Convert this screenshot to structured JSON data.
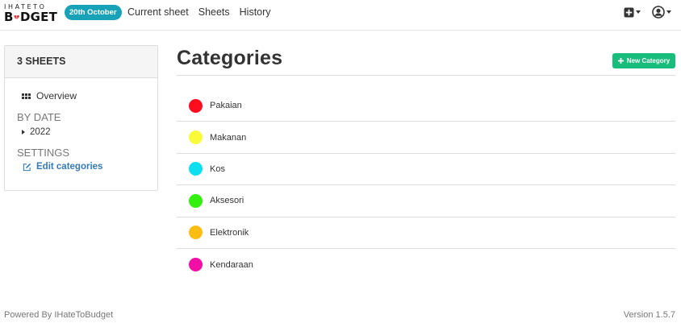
{
  "navbar": {
    "logo_top": "IHATETO",
    "logo_bottom_left": "B",
    "logo_bottom_right": "DGET",
    "date_badge": "20th October",
    "links": [
      "Current sheet",
      "Sheets",
      "History"
    ],
    "icons": [
      "plus-square-icon",
      "user-circle-icon"
    ]
  },
  "sidebar": {
    "header": "3 SHEETS",
    "overview_label": "Overview",
    "by_date_title": "BY DATE",
    "year": "2022",
    "settings_title": "SETTINGS",
    "edit_categories_label": "Edit categories"
  },
  "main": {
    "title": "Categories",
    "new_category_label": "New Category",
    "categories": [
      {
        "name": "Pakaian",
        "color": "#ff0d1f"
      },
      {
        "name": "Makanan",
        "color": "#f9fb39"
      },
      {
        "name": "Kos",
        "color": "#0ddff1"
      },
      {
        "name": "Aksesori",
        "color": "#34f011"
      },
      {
        "name": "Elektronik",
        "color": "#fbbd13"
      },
      {
        "name": "Kendaraan",
        "color": "#f20fa6"
      }
    ]
  },
  "footer": {
    "powered_by": "Powered By IHateToBudget",
    "version": "Version 1.5.7"
  },
  "colors": {
    "accent_badge": "#17a2b8",
    "button_green": "#18bc7b",
    "link_blue": "#337ab7"
  }
}
